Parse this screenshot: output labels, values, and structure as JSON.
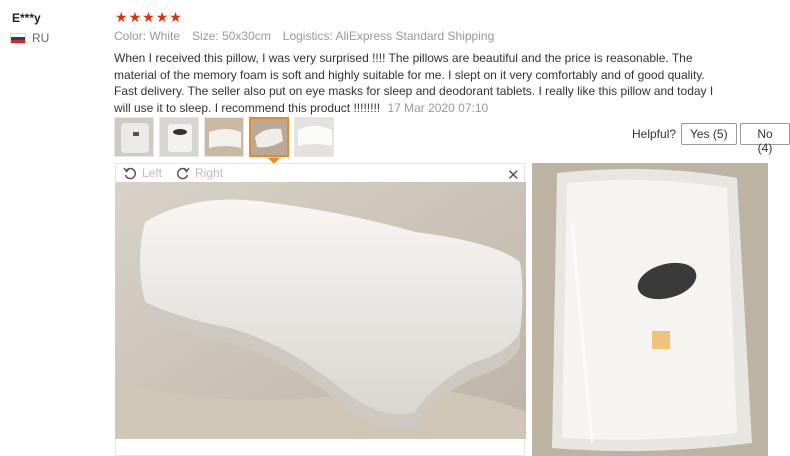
{
  "user": {
    "name": "E***y",
    "country": "RU"
  },
  "rating": {
    "stars": 5,
    "star_glyph": "★",
    "color": "#e62e04"
  },
  "meta": {
    "color_label": "Color:",
    "color_value": "White",
    "size_label": "Size:",
    "size_value": "50x30cm",
    "logistics_label": "Logistics:",
    "logistics_value": "AliExpress Standard Shipping"
  },
  "review": {
    "text": "When I received this pillow, I was very surprised !!!! The pillows are beautiful and the price is reasonable. The material of the memory foam is soft and highly suitable for me. I slept on it very comfortably and of good quality. Fast delivery. The seller also put on eye masks for sleep and deodorant tablets. I really like this pillow and today I will use it to sleep. I recommend this product !!!!!!!!",
    "date": "17 Mar 2020 07:10"
  },
  "thumbnails": [
    "pillow-package",
    "eye-mask-package",
    "pillow-side",
    "pillow-on-bed",
    "pillow-white"
  ],
  "helpful": {
    "label": "Helpful?",
    "yes": "Yes (5)",
    "no": "No (4)"
  },
  "viewer": {
    "left": "Left",
    "right": "Right",
    "close": "✕"
  },
  "colors": {
    "accent": "#e78a2c",
    "star": "#e62e04"
  }
}
